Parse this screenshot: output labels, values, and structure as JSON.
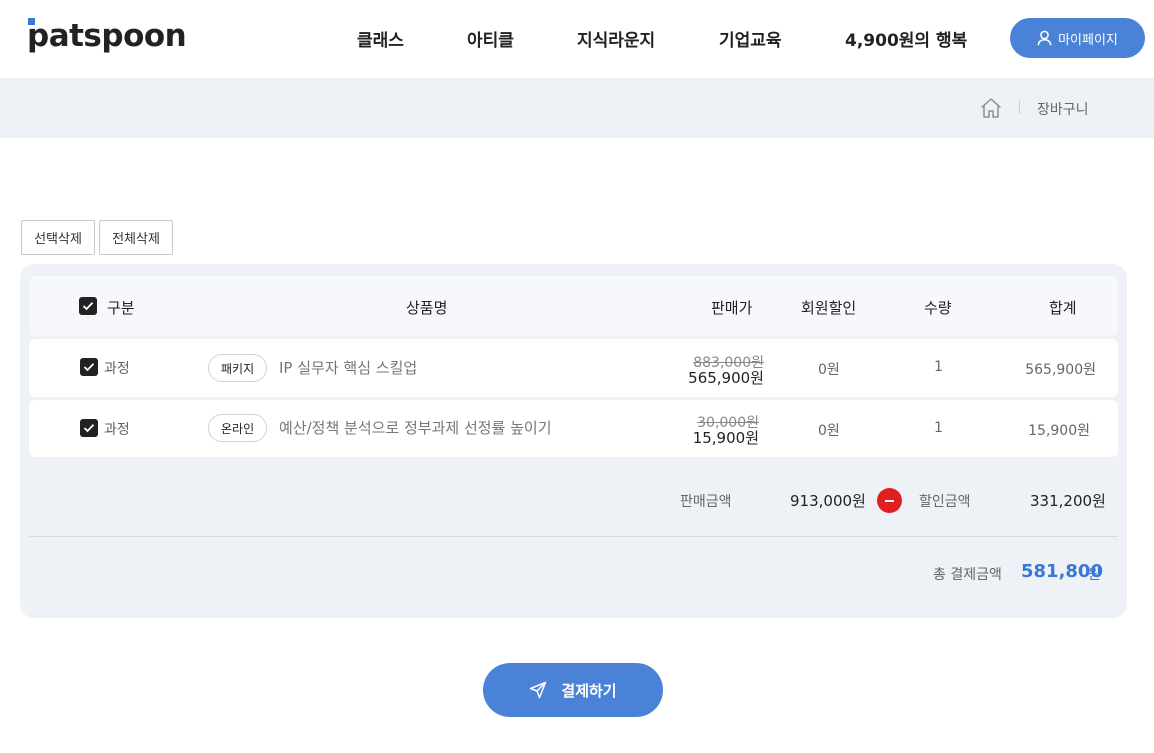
{
  "brand": {
    "logo_text": "patspoon",
    "accent": "#4a82d8",
    "dot_color": "#3a78d6"
  },
  "nav": {
    "items": [
      {
        "label": "클래스"
      },
      {
        "label": "아티클"
      },
      {
        "label": "지식라운지"
      },
      {
        "label": "기업교육"
      },
      {
        "label": "4,900원의 행복"
      }
    ],
    "mypage_label": "마이페이지",
    "mypage_icon": "user-icon"
  },
  "breadcrumb": {
    "home_icon": "home-icon",
    "current": "장바구니"
  },
  "actions": {
    "delete_selected": "선택삭제",
    "delete_all": "전체삭제"
  },
  "cart": {
    "columns": {
      "category": "구분",
      "product": "상품명",
      "price": "판매가",
      "member_discount": "회원할인",
      "quantity": "수량",
      "total": "합계"
    },
    "items": [
      {
        "checked": true,
        "category": "과정",
        "tag": "패키지",
        "name": "IP 실무자 핵심 스킬업",
        "original_price": "883,000원",
        "sale_price": "565,900원",
        "discount": "0원",
        "quantity": "1",
        "total": "565,900원"
      },
      {
        "checked": true,
        "category": "과정",
        "tag": "온라인",
        "name": "예산/정책 분석으로 정부과제 선정률 높이기",
        "original_price": "30,000원",
        "sale_price": "15,900원",
        "discount": "0원",
        "quantity": "1",
        "total": "15,900원"
      }
    ],
    "summary": {
      "sale_amount_label": "판매금액",
      "sale_amount": "913,000원",
      "discount_label": "할인금액",
      "discount_amount": "331,200원",
      "minus_icon": "minus-circle-icon",
      "minus_color": "#e02020",
      "total_label": "총 결제금액",
      "total_value": "581,800",
      "total_unit": "원"
    }
  },
  "pay": {
    "label": "결제하기",
    "icon": "send-icon"
  }
}
